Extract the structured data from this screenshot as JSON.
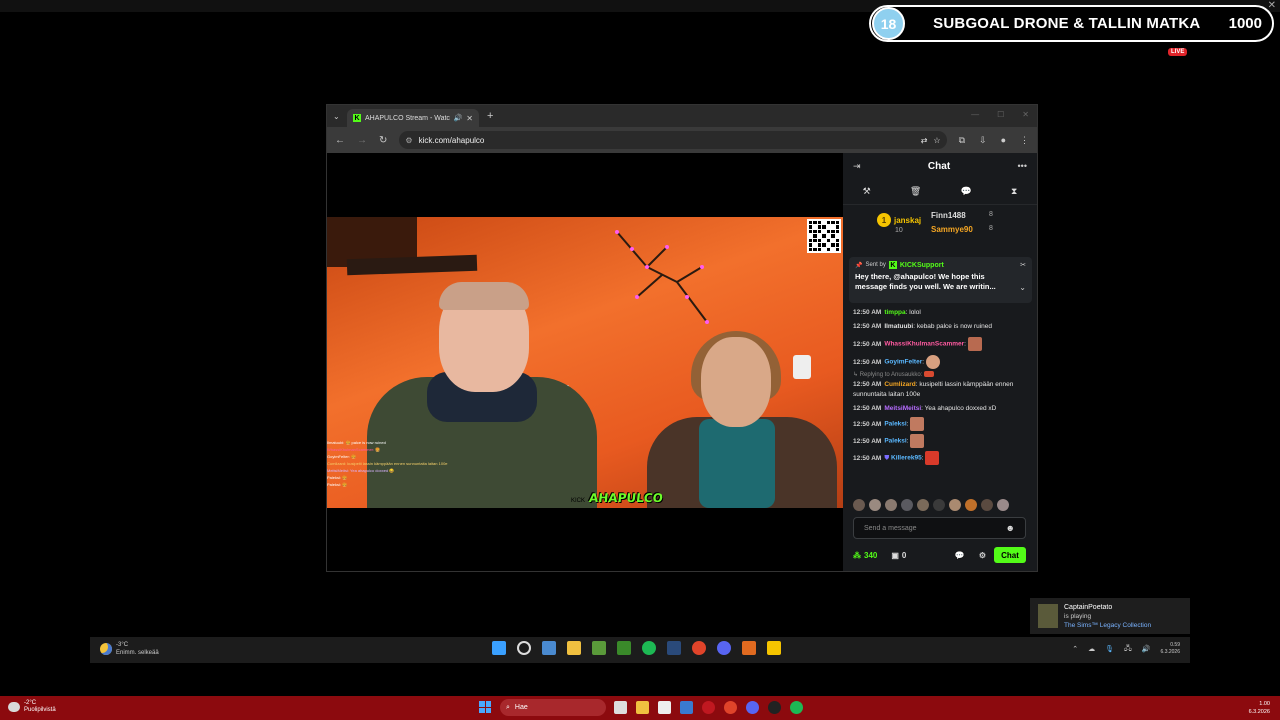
{
  "overlay": {
    "subgoal_count": "18",
    "subgoal_title": "SUBGOAL DRONE & TALLIN MATKA",
    "subgoal_target": "1000",
    "live": "LIVE"
  },
  "browser": {
    "tab_title": "AHAPULCO Stream - Watch",
    "url": "kick.com/ahapulco"
  },
  "video": {
    "watermark": "AHAPULCO",
    "watermark_prefix": "KICK",
    "minichat": [
      "Ilmatuubi: 🍔 palce is now ruined",
      "WhassiKhulmanScammer: 🍔",
      "GoyimFelter: 🍔",
      "Cumlizard: kusipelti lassin kämppään ennen sunnuntaita laitan 100e",
      "MeitsiMeitsi: Yea ahapulco doxxed 😀",
      "Paleksi: 🍔",
      "Paleksi: 🍔"
    ]
  },
  "chat": {
    "title": "Chat",
    "leaders": [
      {
        "name": "janskaj",
        "count": "10"
      },
      {
        "name": "Finn1488",
        "count": "8"
      },
      {
        "name": "Sammye90",
        "count": "8"
      }
    ],
    "pinned": {
      "sent_by": "Sent by",
      "author": "KICKSupport",
      "text": "Hey there, @ahapulco! We hope this message finds you well. We are writin..."
    },
    "messages": [
      {
        "time": "12:50 AM",
        "user": "timppa",
        "color": "#53fc18",
        "text": "lolol"
      },
      {
        "time": "12:50 AM",
        "user": "Ilmatuubi",
        "color": "#e0e0e0",
        "text": "kebab palce is now ruined"
      },
      {
        "time": "12:50 AM",
        "user": "WhassiKhulmanScammer",
        "color": "#ff5aa0",
        "text": ""
      },
      {
        "time": "12:50 AM",
        "user": "GoyimFelter",
        "color": "#5ab8ff",
        "text": ""
      },
      {
        "time": "12:50 AM",
        "user": "Cumlizard",
        "color": "#f5a623",
        "text": "kusipelti lassin kämppään ennen sunnuntaita laitan 100e",
        "reply": "Replying to Anusaukko:"
      },
      {
        "time": "12:50 AM",
        "user": "MeitsiMeitsi",
        "color": "#b66cff",
        "text": "Yea ahapulco doxxed xD"
      },
      {
        "time": "12:50 AM",
        "user": "Paleksi",
        "color": "#5ab8ff",
        "text": ""
      },
      {
        "time": "12:50 AM",
        "user": "Paleksi",
        "color": "#5ab8ff",
        "text": ""
      },
      {
        "time": "12:50 AM",
        "user": "Killerek95",
        "color": "#5ab8ff",
        "text": ""
      }
    ],
    "placeholder": "Send a message",
    "points": "340",
    "drops": "0",
    "send_label": "Chat"
  },
  "notification": {
    "user": "CaptainPoetato",
    "status": "is playing",
    "game": "The Sims™ Legacy Collection"
  },
  "taskbar_inner": {
    "temp": "-3°C",
    "weather": "Enimm. selkeää",
    "time": "0.59",
    "date": "6.3.2026"
  },
  "taskbar_outer": {
    "temp": "-2°C",
    "weather": "Puolipilvistä",
    "search": "Hae",
    "time": "1.00",
    "date": "6.3.2026"
  }
}
